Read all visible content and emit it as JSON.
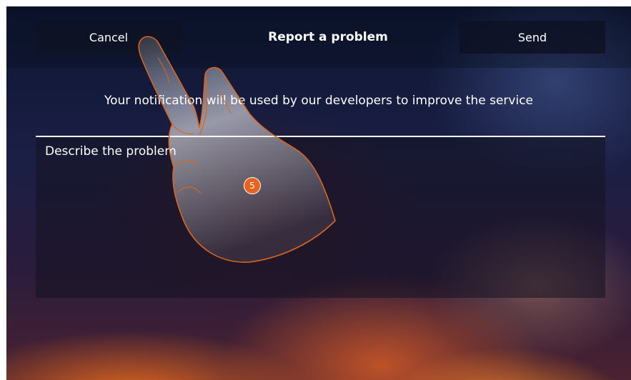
{
  "header": {
    "cancel_label": "Cancel",
    "title": "Report a problem",
    "send_label": "Send"
  },
  "info_text": "Your notification will be used by our developers to improve the service",
  "description_field": {
    "placeholder": "Describe the problem"
  },
  "step_badge": "5",
  "colors": {
    "accent": "#e8641e",
    "button_bg": "#0e1224",
    "text": "#ffffff"
  }
}
